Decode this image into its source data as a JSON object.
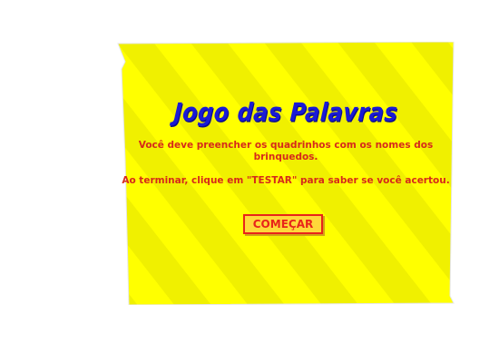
{
  "game": {
    "title": "Jogo das Palavras",
    "instructions": [
      "Você deve preencher os quadrinhos com os nomes dos brinquedos.",
      "Ao terminar, clique em \"TESTAR\" para saber se você acertou."
    ],
    "start_label": "COMEÇAR"
  },
  "colors": {
    "panel_stripe_light": "#ffff00",
    "panel_stripe_dark": "#f0f000",
    "title": "#1a1ad6",
    "instructions": "#d62a1a",
    "button_bg": "#ffd83a",
    "button_border": "#e8241a"
  }
}
